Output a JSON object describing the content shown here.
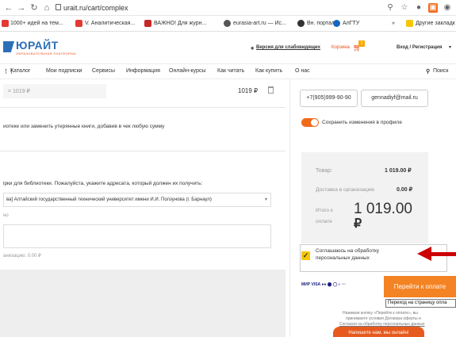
{
  "browser": {
    "url": "urait.ru/cart/complex",
    "bookmarks": [
      {
        "label": "1000+ идей на тем...",
        "color": "#e53935"
      },
      {
        "label": "V. Аналитическая...",
        "color": "#e53935"
      },
      {
        "label": "ВАЖНО! Для журн...",
        "color": "#c62828"
      },
      {
        "label": "eurasia-art.ru — Ис...",
        "color": "#555555"
      },
      {
        "label": "Вн. портал",
        "color": "#333333"
      },
      {
        "label": "АлГТУ",
        "color": "#1565c0"
      },
      {
        "label": "»",
        "color": "#ffffff"
      },
      {
        "label": "Другие закладк",
        "color": "#f6c700"
      }
    ]
  },
  "header": {
    "logo": "ЮРАЙТ",
    "logo_sub": "ОБРАЗОВАТЕЛЬНАЯ ПЛАТФОРМА",
    "accessible": "Версия для слабовидящих",
    "cart": "Корзина",
    "cart_count": "1",
    "login": "Вход / Регистрация"
  },
  "menu": {
    "items": [
      "Каталог",
      "Мои подписки",
      "Сервисы",
      "Информация",
      "Онлайн-курсы",
      "Как читать",
      "Как купить",
      "О нас"
    ],
    "search": "Поиск"
  },
  "left": {
    "price_small": "= 1019 ₽",
    "price_right": "1019 ₽",
    "library_note": "иотеке или заменить утерянные книги, добавив в чек любую сумму",
    "recipient_note": "ірки для библиотеки. Пожалуйста, укажите адресата, который должен их получить:",
    "org_value": "ва] Алтайский государственный технический университет имени И.И. Ползунова (г. Барнаул)",
    "field2_label": "но",
    "delivery_org": "анизацию: 0.00 ₽"
  },
  "right": {
    "phone": "+7(905)999-90-90",
    "email": "gennadiyf@mail.ru",
    "save_label": "Сохранить изменения в профиле",
    "goods_label": "Товар:",
    "goods_value": "1 019.00 ₽",
    "delivery_label": "Доставка в организацию",
    "delivery_value": "0.00 ₽",
    "total_label_1": "Итого к",
    "total_label_2": "оплате",
    "total_value": "1 019.00",
    "total_currency": "₽",
    "agree_1": "Соглашаюсь на обработку",
    "agree_2": "персональных данных",
    "pay_button": "Перейти к оплате",
    "tooltip": "Переход на страницу опла",
    "note_1": "Нажимая кнопку «Перейти к оплате», вы",
    "note_2": "принимаете условия Договора оферты и",
    "note_3": "Согласия на обработку персональных данных",
    "chat": "Напишите нам, мы онлайн!"
  },
  "colors": {
    "accent": "#f48323",
    "brand": "#2c6fb7",
    "arrow": "#cc0000"
  }
}
